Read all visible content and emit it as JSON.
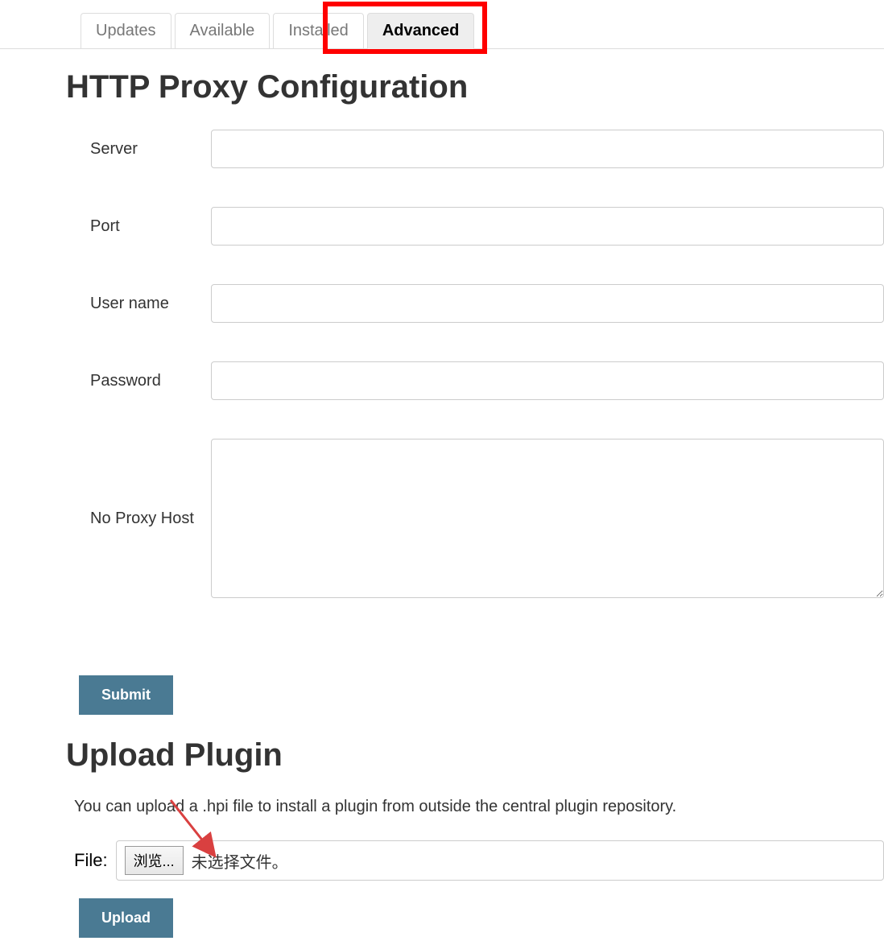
{
  "tabs": {
    "items": [
      {
        "label": "Updates",
        "active": false
      },
      {
        "label": "Available",
        "active": false
      },
      {
        "label": "Installed",
        "active": false
      },
      {
        "label": "Advanced",
        "active": true
      }
    ]
  },
  "proxy": {
    "heading": "HTTP Proxy Configuration",
    "fields": {
      "server": {
        "label": "Server",
        "value": ""
      },
      "port": {
        "label": "Port",
        "value": ""
      },
      "username": {
        "label": "User name",
        "value": ""
      },
      "password": {
        "label": "Password",
        "value": ""
      },
      "noproxy": {
        "label": "No Proxy Host",
        "value": ""
      }
    },
    "submit_label": "Submit"
  },
  "upload": {
    "heading": "Upload Plugin",
    "description": "You can upload a .hpi file to install a plugin from outside the central plugin repository.",
    "file_label": "File:",
    "browse_label": "浏览...",
    "no_file_text": "未选择文件。",
    "upload_label": "Upload"
  }
}
